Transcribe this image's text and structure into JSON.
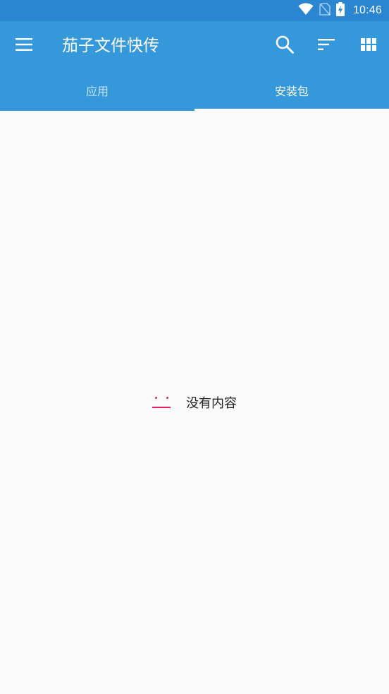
{
  "status_bar": {
    "time": "10:46",
    "icons": [
      "wifi-icon",
      "no-sim-icon",
      "battery-charging-icon"
    ]
  },
  "app_bar": {
    "title": "茄子文件快传",
    "actions": [
      "menu-icon",
      "search-icon",
      "sort-icon",
      "grid-view-icon"
    ],
    "color": "#3498db",
    "status_color": "#2a86d0"
  },
  "tabs": [
    {
      "label": "应用",
      "active": false
    },
    {
      "label": "安装包",
      "active": true
    }
  ],
  "empty_state": {
    "icon": "empty-face-icon",
    "message": "没有内容",
    "accent_color": "#e0245e"
  }
}
